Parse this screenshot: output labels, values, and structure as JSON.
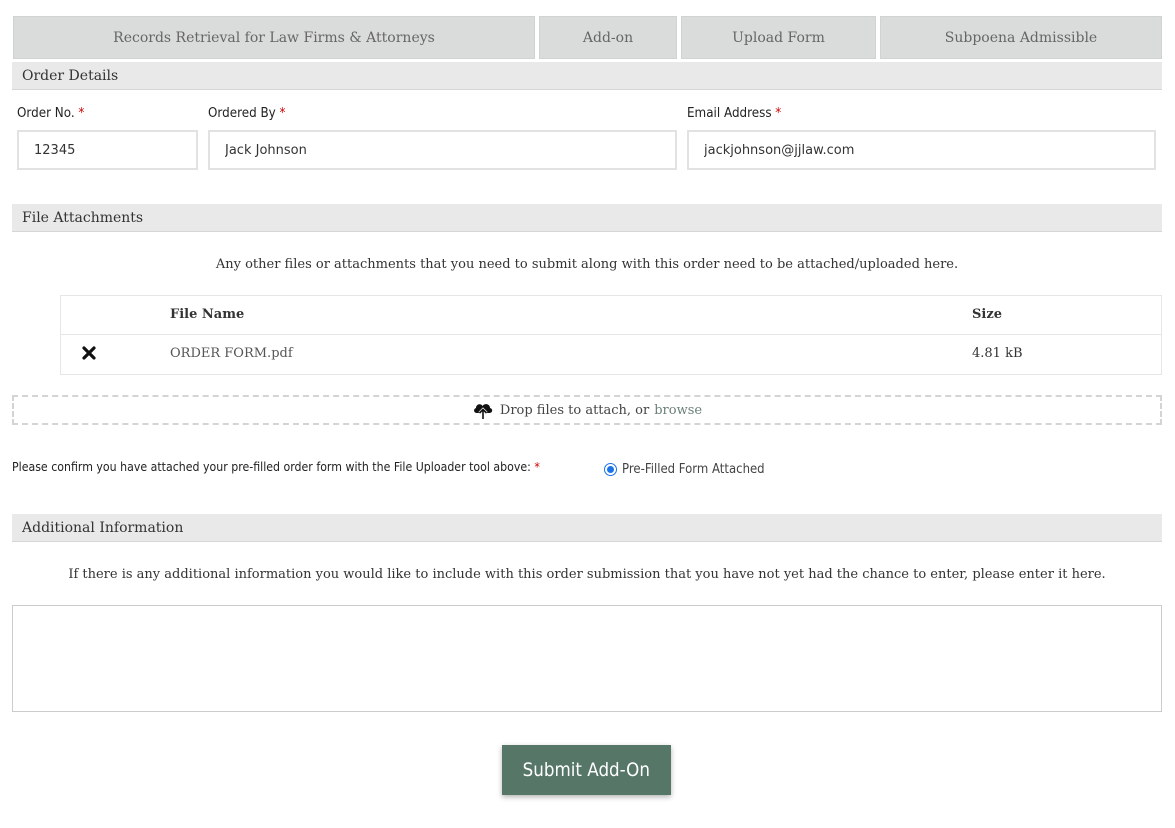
{
  "tabs": [
    {
      "label": "Records Retrieval for Law Firms & Attorneys"
    },
    {
      "label": "Add-on"
    },
    {
      "label": "Upload Form"
    },
    {
      "label": "Subpoena Admissible"
    }
  ],
  "order_details": {
    "heading": "Order Details",
    "order_no": {
      "label": "Order No.",
      "value": "12345"
    },
    "ordered_by": {
      "label": "Ordered By",
      "value": "Jack Johnson"
    },
    "email": {
      "label": "Email Address",
      "value": "jackjohnson@jjlaw.com"
    },
    "required_mark": "*"
  },
  "file_attachments": {
    "heading": "File Attachments",
    "intro": "Any other files or attachments that you need to submit along with this order need to be attached/uploaded here.",
    "columns": {
      "name": "File Name",
      "size": "Size"
    },
    "files": [
      {
        "name": "ORDER FORM.pdf",
        "size": "4.81 kB",
        "remove_icon": "close-x-icon"
      }
    ],
    "dropzone": {
      "text": "Drop files to attach, or",
      "browse": "browse",
      "icon": "cloud-upload-icon"
    }
  },
  "confirm": {
    "label": "Please confirm you have attached your pre-filled order form with the File Uploader tool above:",
    "option": "Pre-Filled Form Attached",
    "checked": true
  },
  "additional_info": {
    "heading": "Additional Information",
    "intro": "If there is any additional information you would like to include with this order submission that you have not yet had the chance to enter, please enter it here.",
    "value": ""
  },
  "submit": {
    "label": "Submit Add-On"
  },
  "colors": {
    "tab_bg": "#d9dcdb",
    "section_bg": "#e9e9e9",
    "required": "#cc0000",
    "accent": "#567668",
    "radio": "#1a73e8"
  }
}
